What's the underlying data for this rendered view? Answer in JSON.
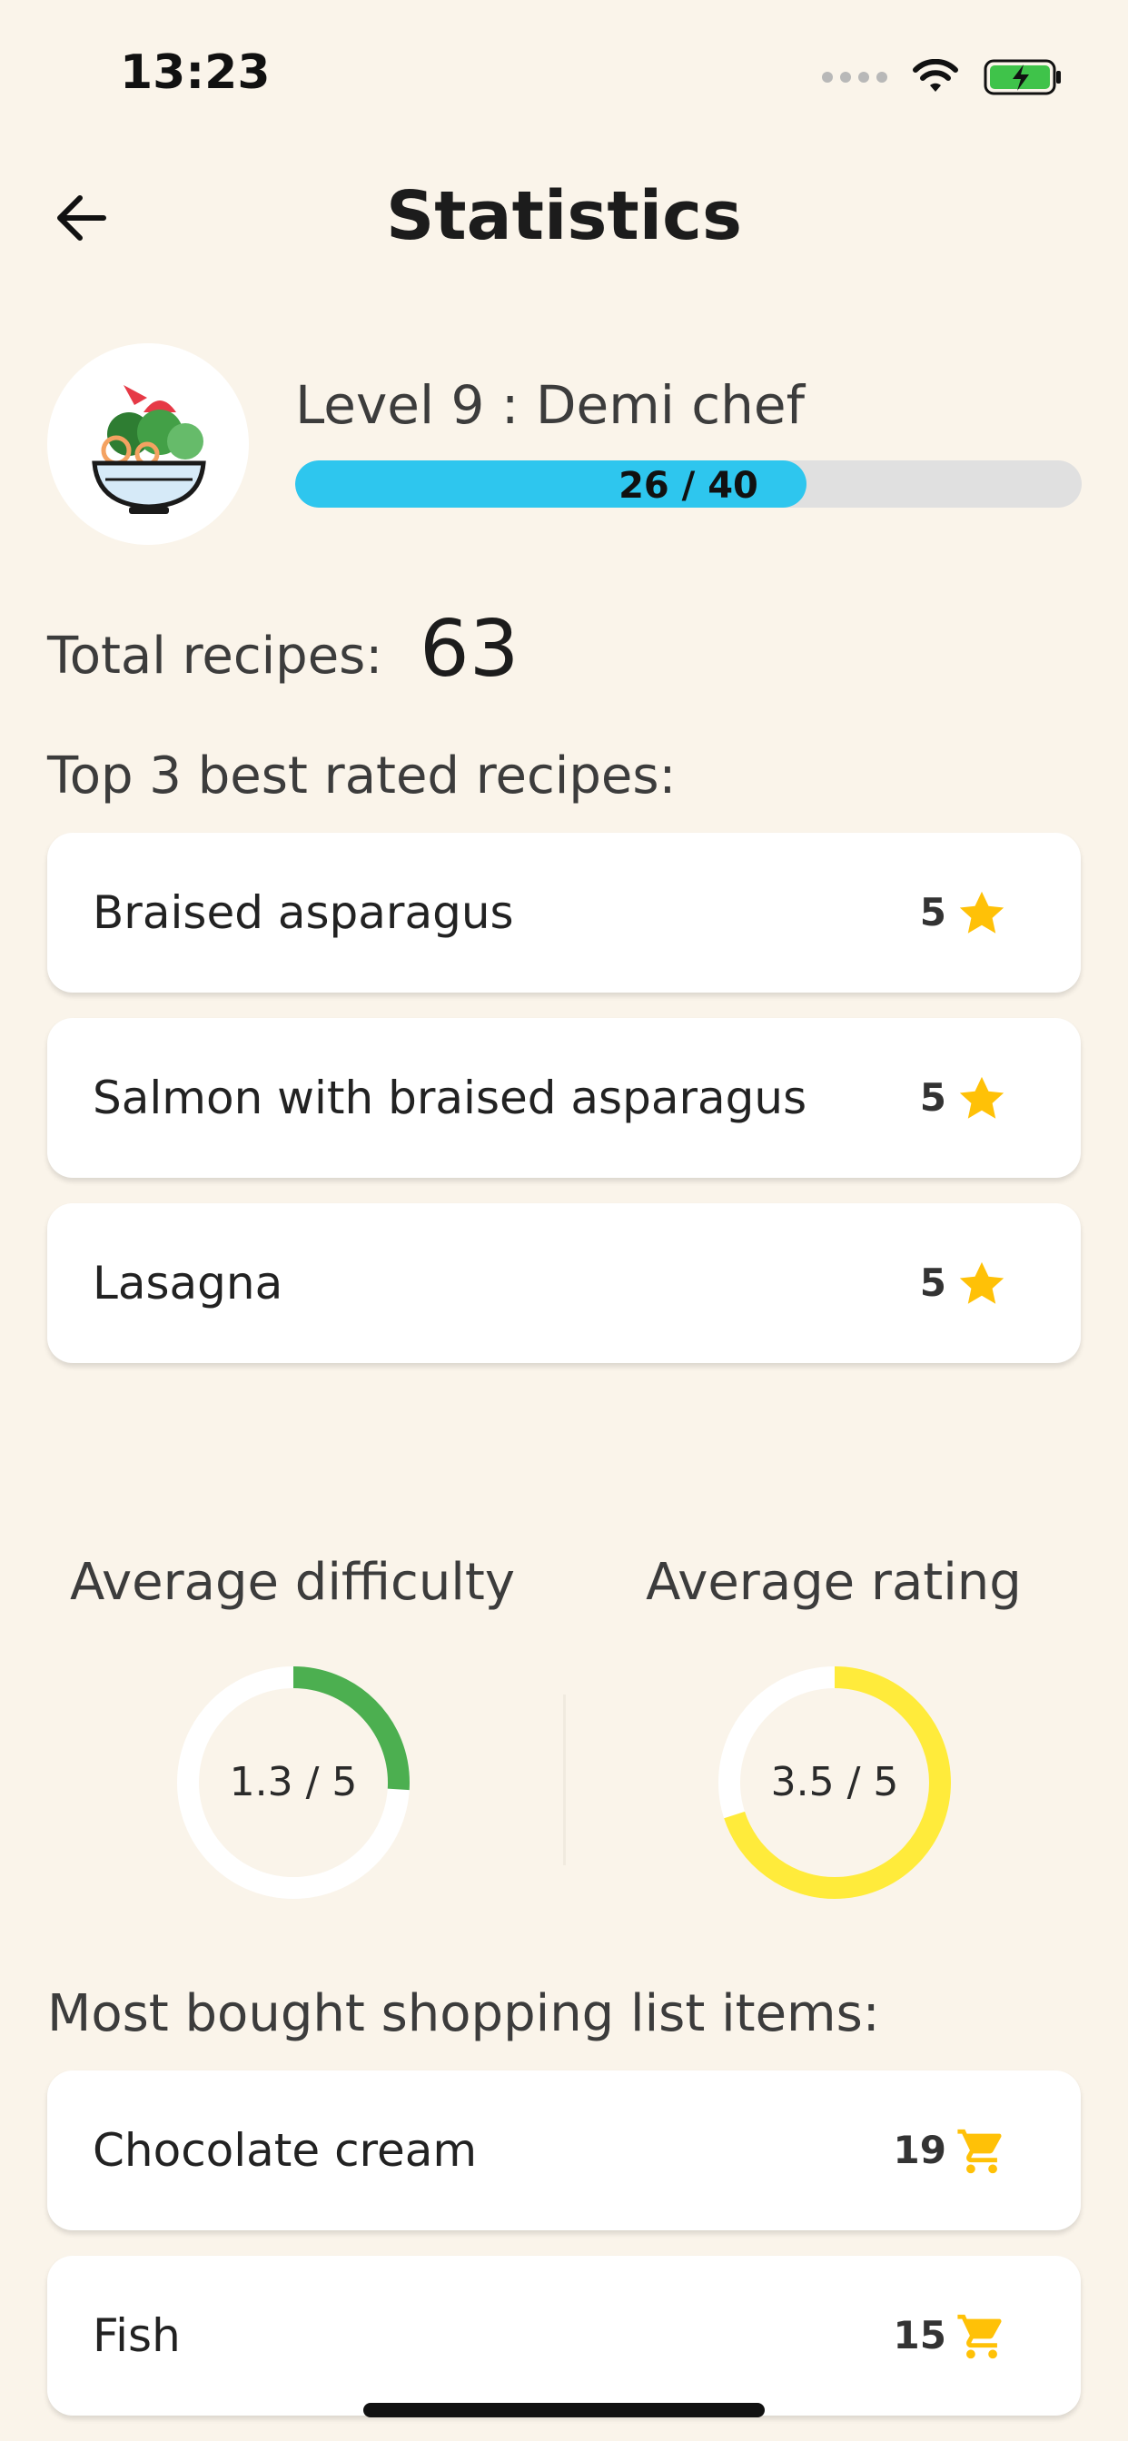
{
  "status_bar": {
    "time": "13:23"
  },
  "header": {
    "title": "Statistics"
  },
  "level": {
    "label": "Level 9 : Demi chef",
    "progress_text": "26 / 40",
    "current": 26,
    "max": 40
  },
  "total": {
    "label": "Total recipes:",
    "value": "63"
  },
  "top_rated": {
    "title": "Top 3 best rated recipes:",
    "items": [
      {
        "name": "Braised asparagus",
        "rating": "5"
      },
      {
        "name": "Salmon with braised asparagus",
        "rating": "5"
      },
      {
        "name": "Lasagna",
        "rating": "5"
      }
    ]
  },
  "averages": {
    "difficulty": {
      "title": "Average difficulty",
      "text": "1.3 / 5",
      "value": 1.3,
      "max": 5,
      "color": "#4caf50"
    },
    "rating": {
      "title": "Average rating",
      "text": "3.5 / 5",
      "value": 3.5,
      "max": 5,
      "color": "#ffeb3b"
    }
  },
  "shopping": {
    "title": "Most bought shopping list items:",
    "items": [
      {
        "name": "Chocolate cream",
        "count": "19"
      },
      {
        "name": "Fish",
        "count": "15"
      }
    ]
  },
  "colors": {
    "accent": "#2ec6ee",
    "star": "#ffc107",
    "cart": "#ffc107",
    "background": "#faf4ea"
  },
  "icons": {
    "back": "arrow-left-icon",
    "star": "star-icon",
    "cart": "cart-icon",
    "avatar": "salad-bowl-icon"
  }
}
